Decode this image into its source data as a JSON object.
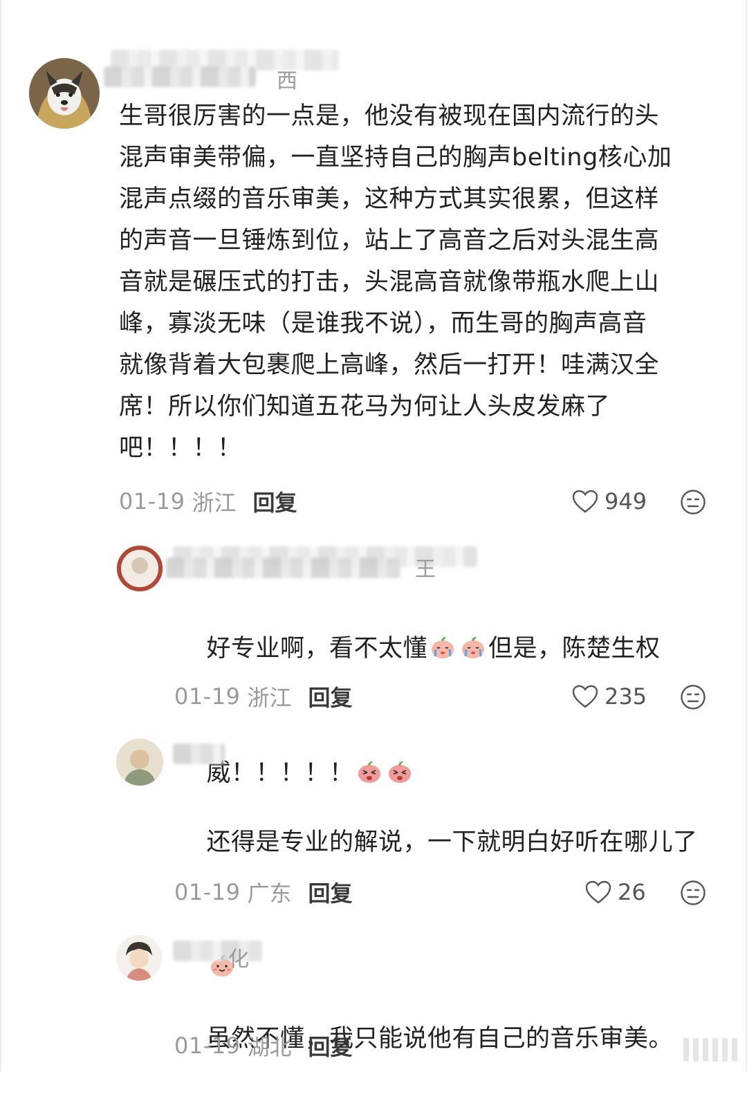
{
  "comments": [
    {
      "name_tail": "西",
      "text": "生哥很厉害的一点是，他没有被现在国内流行的头\n混声审美带偏，一直坚持自己的胸声belting核心加\n混声点缀的音乐审美，这种方式其实很累，但这样\n的声音一旦锤炼到位，站上了高音之后对头混生高\n音就是碾压式的打击，头混高音就像带瓶水爬上山\n峰，寡淡无味（是谁我不说），而生哥的胸声高音\n就像背着大包裹爬上高峰，然后一打开！哇满汉全\n席！所以你们知道五花马为何让人头皮发麻了\n吧！！！！",
      "date": "01-19",
      "location": "浙江",
      "reply_label": "回复",
      "likes": "949"
    },
    {
      "name_tail": "王",
      "text_line1": "好专业啊，看不太懂",
      "text_line1b": "但是，陈楚生权",
      "text_line2": "威！！！！！",
      "date": "01-19",
      "location": "浙江",
      "reply_label": "回复",
      "likes": "235"
    },
    {
      "name_tail": "",
      "text_line1": "还得是专业的解说，一下就明白好听在哪儿了",
      "date": "01-19",
      "location": "广东",
      "reply_label": "回复",
      "likes": "26"
    },
    {
      "name_tail": "化",
      "text_line1": "虽然不懂，我只能说他有自己的音乐审美。",
      "date": "01-19",
      "location": "湖北",
      "reply_label": "回复"
    }
  ],
  "icons": {
    "like": "heart-outline-icon",
    "reaction": "neutral-face-icon"
  },
  "colors": {
    "meta_text": "#9a9a9a",
    "reply_text": "#3a3a3a",
    "body_text": "#222222"
  }
}
